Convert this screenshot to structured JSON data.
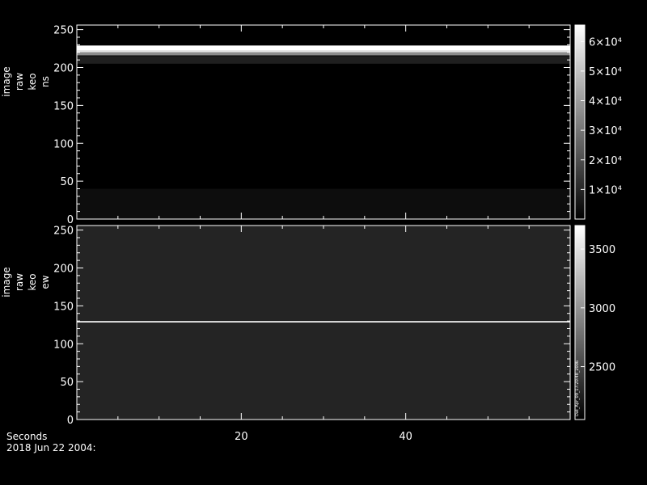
{
  "chart_data": [
    {
      "type": "heatmap",
      "panel": "ns",
      "ylabel_lines": [
        "image",
        "raw",
        "keo",
        "ns"
      ],
      "xlim": [
        0,
        60
      ],
      "ylim": [
        0,
        256
      ],
      "yticks": [
        0,
        50,
        100,
        150,
        200,
        250
      ],
      "colorbar": {
        "range": [
          0,
          65535
        ],
        "tick_labels": [
          "6×10⁴",
          "5×10⁴",
          "4×10⁴",
          "3×10⁴",
          "2×10⁴",
          "1×10⁴"
        ],
        "tick_values": [
          60000,
          50000,
          40000,
          30000,
          20000,
          10000
        ]
      },
      "bands": [
        {
          "y0": 0,
          "y1": 40,
          "level": 0.05
        },
        {
          "y0": 205,
          "y1": 215,
          "level": 0.12
        },
        {
          "y0": 216,
          "y1": 220,
          "level": 0.55
        },
        {
          "y0": 220,
          "y1": 222,
          "level": 0.9
        },
        {
          "y0": 222,
          "y1": 229,
          "level": 1.0
        }
      ]
    },
    {
      "type": "heatmap",
      "panel": "ew",
      "ylabel_lines": [
        "image",
        "raw",
        "keo",
        "ew"
      ],
      "xlim": [
        0,
        60
      ],
      "ylim": [
        0,
        256
      ],
      "yticks": [
        0,
        50,
        100,
        150,
        200,
        250
      ],
      "colorbar": {
        "range": [
          2050,
          3700
        ],
        "tick_labels": [
          "3500",
          "3000",
          "2500"
        ],
        "tick_values": [
          3500,
          3000,
          2500
        ]
      },
      "background_level": 0.14,
      "bands": [
        {
          "y0": 128,
          "y1": 130,
          "level": 0.9
        }
      ],
      "side_note": "Dat_Apr_09_17:20:48_2006"
    }
  ],
  "xaxis": {
    "title": "Seconds",
    "tick_values": [
      20,
      40
    ],
    "tick_labels": [
      "20",
      "40"
    ]
  },
  "date_label": "2018 Jun 22 2004:"
}
